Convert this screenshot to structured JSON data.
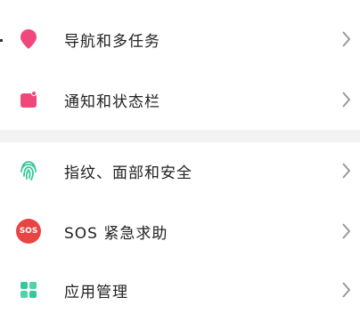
{
  "settings": {
    "items": [
      {
        "label": "导航和多任务",
        "icon": "location-pin-icon",
        "color": "#f0487a"
      },
      {
        "label": "通知和状态栏",
        "icon": "notification-icon",
        "color": "#f0487a"
      },
      {
        "label": "指纹、面部和安全",
        "icon": "fingerprint-icon",
        "color": "#35c99a"
      },
      {
        "label": "SOS 紧急求助",
        "icon": "sos-icon",
        "color": "#e94343",
        "badge_text": "SOS"
      },
      {
        "label": "应用管理",
        "icon": "apps-grid-icon",
        "color": "#35c99a"
      }
    ]
  }
}
